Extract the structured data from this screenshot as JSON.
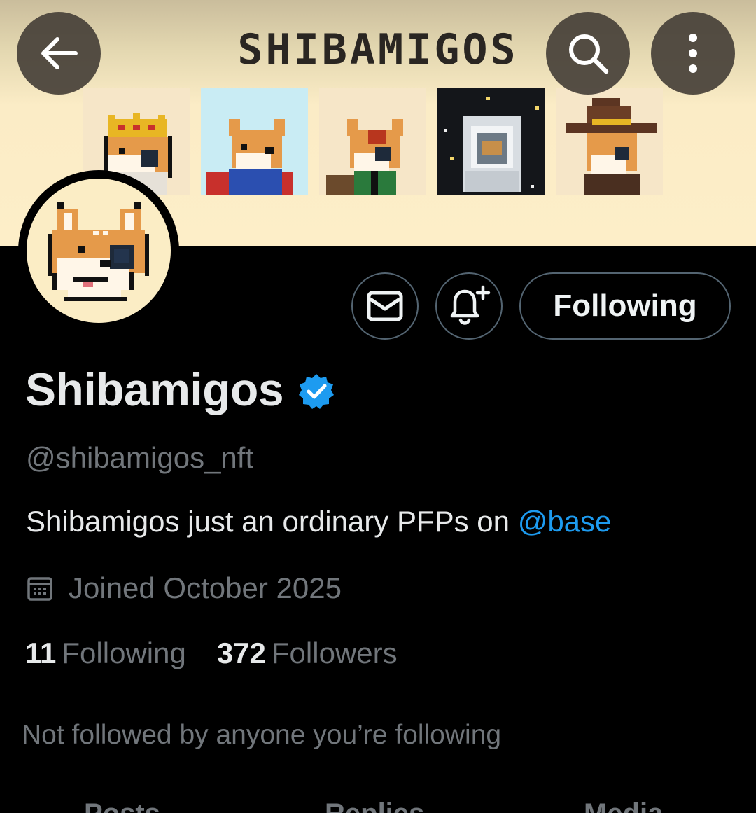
{
  "header": {
    "banner_title": "SHIBAMIGOS",
    "back_icon": "arrow-left-icon",
    "search_icon": "search-icon",
    "more_icon": "more-vertical-icon"
  },
  "banner": {
    "nfts": [
      "king-shiba",
      "caped-shiba",
      "scarred-shiba",
      "astronaut-shiba",
      "cowboy-shiba"
    ]
  },
  "actions": {
    "message_icon": "mail-icon",
    "notify_icon": "bell-plus-icon",
    "following_label": "Following"
  },
  "profile": {
    "display_name": "Shibamigos",
    "verified": true,
    "handle": "@shibamigos_nft",
    "bio_text": "Shibamigos just an ordinary PFPs on ",
    "bio_mention": "@base",
    "joined": "Joined October 2025",
    "following_count": "11",
    "following_label": "Following",
    "followers_count": "372",
    "followers_label": "Followers",
    "not_followed": "Not followed by anyone you’re following"
  },
  "tabs": [
    "Posts",
    "Replies",
    "Media"
  ],
  "colors": {
    "accent": "#1d9bf0",
    "muted": "#71767b",
    "banner_bg": "#fdeec8"
  }
}
